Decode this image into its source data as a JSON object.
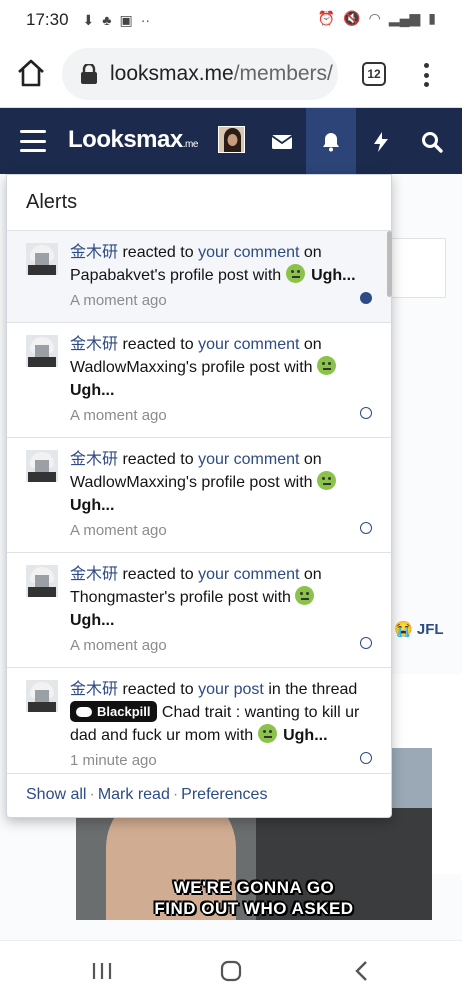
{
  "status_bar": {
    "time": "17:30"
  },
  "browser": {
    "url_host": "looksmax.me",
    "url_path": "/members/",
    "tab_count": "12"
  },
  "site": {
    "logo_text": "Looksmax",
    "logo_suffix": ".me"
  },
  "alerts_menu": {
    "title": "Alerts",
    "items": [
      {
        "user": "金木研",
        "action": " reacted to ",
        "link": "your comment",
        "post": " on Papabakvet's profile post with ",
        "reaction": "Ugh...",
        "time": "A moment ago"
      },
      {
        "user": "金木研",
        "action": " reacted to ",
        "link": "your comment",
        "post": " on WadlowMaxxing's profile post with ",
        "reaction": "Ugh...",
        "time": "A moment ago"
      },
      {
        "user": "金木研",
        "action": " reacted to ",
        "link": "your comment",
        "post": " on WadlowMaxxing's profile post with ",
        "reaction": "Ugh...",
        "time": "A moment ago"
      },
      {
        "user": "金木研",
        "action": " reacted to ",
        "link": "your comment",
        "post": " on Thongmaster's profile post with ",
        "reaction": "Ugh...",
        "time": "A moment ago"
      },
      {
        "user": "金木研",
        "action": " reacted to ",
        "link": "your post",
        "post": " in the thread ",
        "prefix": "Blackpill",
        "thread": " Chad trait : wanting to kill ur dad and fuck ur mom with ",
        "reaction": "Ugh...",
        "time": "1 minute ago"
      }
    ],
    "footer": {
      "show_all": "Show all",
      "mark_read": "Mark read",
      "preferences": "Preferences"
    }
  },
  "background": {
    "jfl_label": "JFL",
    "meme_line1": "WE'RE GONNA GO",
    "meme_line2": "FIND OUT WHO ASKED"
  }
}
